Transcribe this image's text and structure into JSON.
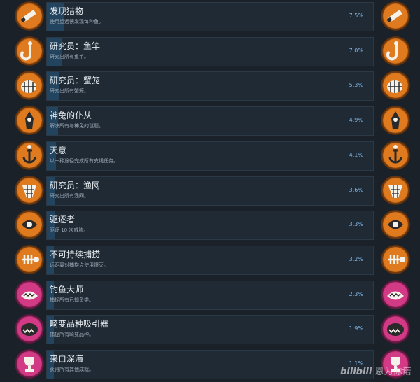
{
  "colors": {
    "orange_badge": "#e07a1f",
    "pink_badge": "#d23a86",
    "panel_bg": "#1f2a35",
    "progress_fill": "#23445e",
    "percent_text": "#7fb6e6"
  },
  "achievements": [
    {
      "title": "发现猎物",
      "desc": "使用望远镜发现每种鱼。",
      "percent": "7.5%",
      "progress": 0.075,
      "badge": "orange",
      "icon": "telescope-icon"
    },
    {
      "title": "研究员：鱼竿",
      "desc": "研究出所有鱼竿。",
      "percent": "7.0%",
      "progress": 0.07,
      "badge": "orange",
      "icon": "fishing-hook-gear-icon"
    },
    {
      "title": "研究员：蟹笼",
      "desc": "研究出所有蟹笼。",
      "percent": "5.3%",
      "progress": 0.053,
      "badge": "orange",
      "icon": "crab-pot-gear-icon"
    },
    {
      "title": "神兔的仆从",
      "desc": "解决所有与神兔的谜题。",
      "percent": "4.9%",
      "progress": 0.049,
      "badge": "orange",
      "icon": "idol-icon"
    },
    {
      "title": "天意",
      "desc": "以一种途径完成所有支线任务。",
      "percent": "4.1%",
      "progress": 0.041,
      "badge": "orange",
      "icon": "anchor-icon"
    },
    {
      "title": "研究员：渔网",
      "desc": "研究出所有渔网。",
      "percent": "3.6%",
      "progress": 0.036,
      "badge": "orange",
      "icon": "net-gear-icon"
    },
    {
      "title": "驱逐者",
      "desc": "驱逐 10 次威胁。",
      "percent": "3.3%",
      "progress": 0.033,
      "badge": "orange",
      "icon": "eye-sigil-icon"
    },
    {
      "title": "不可持续捕捞",
      "desc": "远距离对捕捞点使用爆灭。",
      "percent": "3.2%",
      "progress": 0.032,
      "badge": "orange",
      "icon": "fish-skeleton-icon"
    },
    {
      "title": "钓鱼大师",
      "desc": "捕捉所有已知鱼类。",
      "percent": "2.3%",
      "progress": 0.023,
      "badge": "pink",
      "icon": "angler-fish-icon"
    },
    {
      "title": "畸变品种吸引器",
      "desc": "捕捉所有畸变品种。",
      "percent": "1.9%",
      "progress": 0.019,
      "badge": "pink",
      "icon": "fanged-fish-icon"
    },
    {
      "title": "来自深海",
      "desc": "获得所有其他成就。",
      "percent": "1.1%",
      "progress": 0.011,
      "badge": "pink",
      "icon": "trophy-icon"
    }
  ],
  "watermark": {
    "logo": "bilibili",
    "text": "恩为你诺"
  }
}
